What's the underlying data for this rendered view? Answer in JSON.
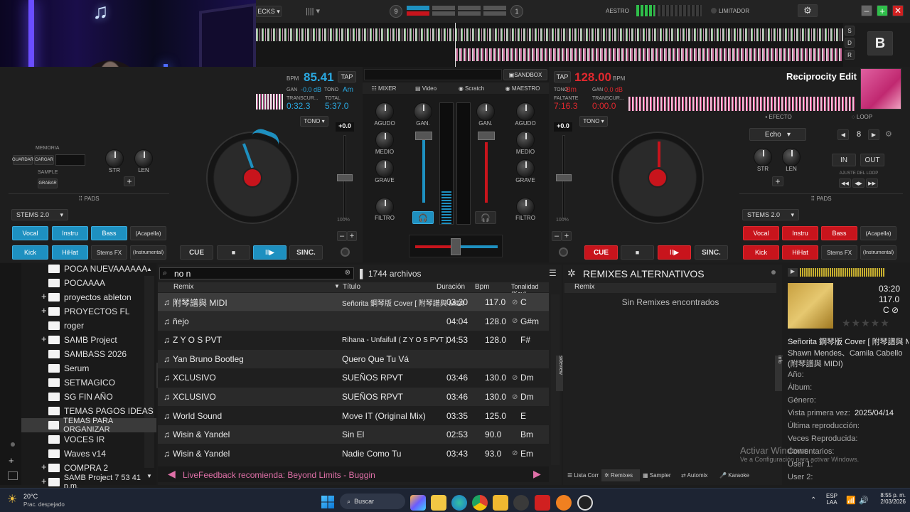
{
  "top": {
    "decks_label": "ECKS",
    "deck_count": "9",
    "deck_count_right": "1",
    "master_label": "AESTRO",
    "limiter_label": "LIMITADOR",
    "skin_letter": "B",
    "sdr": [
      "S",
      "D",
      "R"
    ]
  },
  "left_deck": {
    "bpm_label": "BPM",
    "bpm": "85.41",
    "tap": "TAP",
    "gain_label": "GAN",
    "gain": "-0.0 dB",
    "key_label": "TONO",
    "key": "Am",
    "elapsed_label": "TRANSCUR...",
    "elapsed": "0:32.3",
    "total_label": "TOTAL",
    "total": "5:37.0",
    "pitch": "+0.0",
    "tono": "TONO",
    "pct": "100%",
    "memory": "MEMORIA",
    "guardar": "GUARDAR",
    "cargar": "CARGAR",
    "sample": "SAMPLE",
    "grabar": "GRABAR",
    "str": "STR",
    "len": "LEN",
    "pads": "PADS",
    "stems": "STEMS 2.0",
    "pad_buttons": [
      "Vocal",
      "Instru",
      "Bass",
      "(Acapella)",
      "Kick",
      "HiHat",
      "Stems FX",
      "(Instrumental)"
    ],
    "cue": "CUE",
    "stop": "■",
    "play": "II▶",
    "sync": "SINC."
  },
  "right_deck": {
    "tap": "TAP",
    "bpm": "128.00",
    "bpm_label": "BPM",
    "key_label": "TONO",
    "key": "Bm",
    "gain_label": "GAN",
    "gain": "0.0 dB",
    "remaining_label": "FALTANTE",
    "remaining": "7:16.3",
    "elapsed_label": "TRANSCUR...",
    "elapsed": "0:00.0",
    "title": "Reciprocity Edit",
    "pitch": "+0.0",
    "tono": "TONO",
    "pct": "100%",
    "efecto": "EFECTO",
    "effect": "Echo",
    "loop": "LOOP",
    "loop_value": "8",
    "in": "IN",
    "out": "OUT",
    "loop_adjust": "AJUSTE DEL LOOP",
    "str": "STR",
    "len": "LEN",
    "pads": "PADS",
    "stems": "STEMS 2.0",
    "pad_buttons": [
      "Vocal",
      "Instru",
      "Bass",
      "(Acapella)",
      "Kick",
      "HiHat",
      "Stems FX",
      "(Instrumental)"
    ],
    "cue": "CUE",
    "stop": "■",
    "play": "II▶",
    "sync": "SINC."
  },
  "mixer": {
    "sandbox": "SANDBOX",
    "tabs": [
      "MIXER",
      "Video",
      "Scratch",
      "MAESTRO"
    ],
    "agudo": "AGUDO",
    "medio": "MEDIO",
    "grave": "GRAVE",
    "filtro": "FILTRO",
    "gan": "GAN."
  },
  "browser": {
    "search": "no n",
    "count": "1744 archivos",
    "columns": [
      "Remix",
      "Título",
      "Duración",
      "Bpm",
      "Tonalidad (Key)"
    ],
    "rows": [
      {
        "remix": "附琴譜與 MIDI",
        "title": "Señorita 鋼琴版 Cover [ 附琴譜與 MIDI",
        "dur": "03:20",
        "bpm": "117.0",
        "key": "C"
      },
      {
        "remix": "ñejo",
        "title": "",
        "dur": "04:04",
        "bpm": "128.0",
        "key": "G#m"
      },
      {
        "remix": "Z Y O S PVT",
        "title": "Rihana - Unfaifull ( Z Y O S PVT )",
        "dur": "04:53",
        "bpm": "128.0",
        "key": "F#"
      },
      {
        "remix": "Yan Bruno Bootleg",
        "title": "Quero Que Tu Vá",
        "dur": "",
        "bpm": "",
        "key": ""
      },
      {
        "remix": "XCLUSIVO",
        "title": "SUEÑOS RPVT",
        "dur": "03:46",
        "bpm": "130.0",
        "key": "Dm"
      },
      {
        "remix": "XCLUSIVO",
        "title": "SUEÑOS RPVT",
        "dur": "03:46",
        "bpm": "130.0",
        "key": "Dm"
      },
      {
        "remix": "World Sound",
        "title": "Move IT (Original Mix)",
        "dur": "03:35",
        "bpm": "125.0",
        "key": "E"
      },
      {
        "remix": "Wisin & Yandel",
        "title": "Sin El",
        "dur": "02:53",
        "bpm": "90.0",
        "key": "Bm"
      },
      {
        "remix": "Wisin & Yandel",
        "title": "Nadie Como Tu",
        "dur": "03:43",
        "bpm": "93.0",
        "key": "Em"
      }
    ],
    "livefeedback": "LiveFeedback recomienda: Beyond Limits - Buggin",
    "folders_tab": "folders",
    "sideview_tab": "sideview"
  },
  "folders": [
    "POCA NUEVAAAAAA",
    "POCAAAA",
    "proyectos ableton",
    "PROYECTOS FL",
    "roger",
    "SAMB Project",
    "SAMBASS 2026",
    "Serum",
    "SETMAGICO",
    "SG FIN AÑO",
    "TEMAS PAGOS IDEAS",
    "TEMAS PARA ORGANIZAR",
    "VOCES IR",
    "Waves v14",
    "COMPRA 2",
    "SAMB Project 7 53 41 p.m."
  ],
  "remixes_panel": {
    "title": "REMIXES ALTERNATIVOS",
    "col": "Remix",
    "empty": "Sin Remixes encontrados",
    "tabs": [
      "Lista Corr",
      "Remixes",
      "Sampler",
      "Automix",
      "Karaoke"
    ]
  },
  "info": {
    "time": "03:20",
    "bpm": "117.0",
    "key": "C",
    "title": "Señorita 鋼琴版 Cover [ 附琴譜與 MIDI ]",
    "artist": "Shawn Mendes、Camila Cabello",
    "extra": "(附琴譜與 MIDI)",
    "fields": [
      "Año:",
      "Álbum:",
      "Género:",
      "Vista primera vez:",
      "Última reproducción:",
      "Veces Reproducida:",
      "Comentarios:",
      "User 1:",
      "User 2:"
    ],
    "first_seen": "2025/04/14",
    "info_tab": "info"
  },
  "watermark": {
    "line1": "Activar Windows",
    "line2": "Ve a Configuración para activar Windows."
  },
  "taskbar": {
    "temp": "20°C",
    "weather": "Prac. despejado",
    "search": "Buscar",
    "lang1": "ESP",
    "lang2": "LAA",
    "time": "8:55 p. m.",
    "date": "2/03/2026"
  },
  "colors": {
    "left_accent": "#1e90c0",
    "right_accent": "#c8141c",
    "bg": "#1c1c1c"
  }
}
